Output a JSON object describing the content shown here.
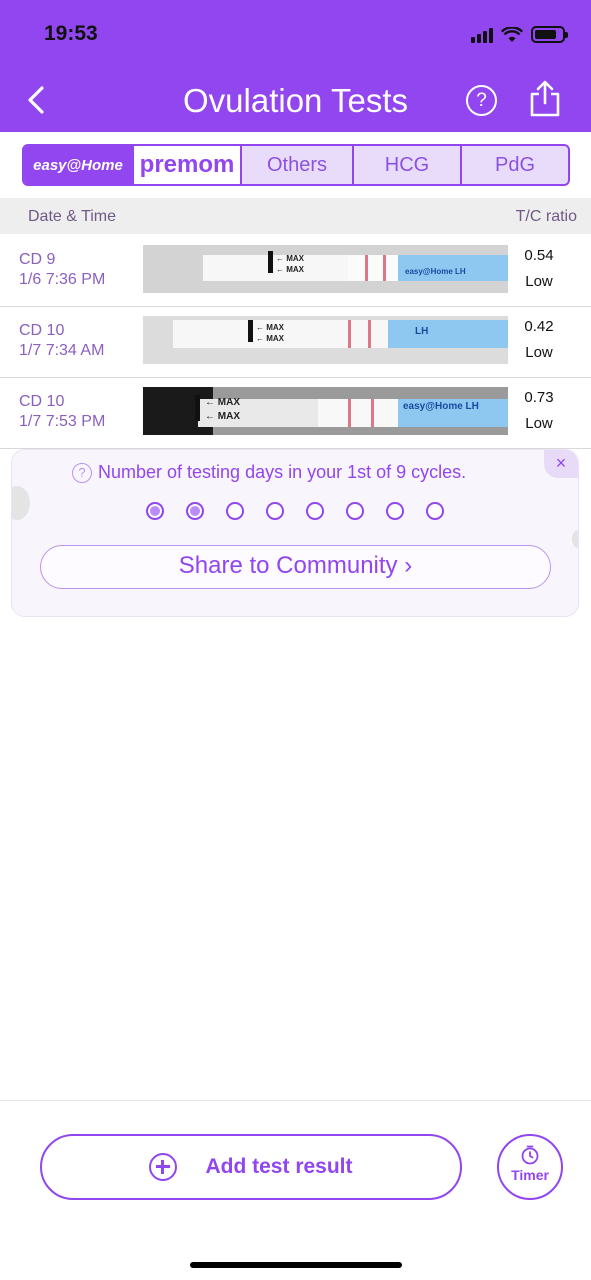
{
  "status_bar": {
    "time": "19:53"
  },
  "header": {
    "title": "Ovulation Tests",
    "help_label": "?"
  },
  "tabs": [
    {
      "label": "easy@Home"
    },
    {
      "label": "premom"
    },
    {
      "label": "Others"
    },
    {
      "label": "HCG"
    },
    {
      "label": "PdG"
    }
  ],
  "list_header": {
    "left": "Date & Time",
    "right": "T/C ratio"
  },
  "rows": [
    {
      "cd": "CD 9",
      "datetime": "1/6 7:36 PM",
      "ratio": "0.54",
      "level": "Low",
      "strip_text": "MAX",
      "brand_text": "easy@Home LH"
    },
    {
      "cd": "CD 10",
      "datetime": "1/7 7:34 AM",
      "ratio": "0.42",
      "level": "Low",
      "strip_text": "MAX",
      "brand_text": "LH"
    },
    {
      "cd": "CD 10",
      "datetime": "1/7 7:53 PM",
      "ratio": "0.73",
      "level": "Low",
      "strip_text": "MAX",
      "brand_text": "easy@Home LH"
    }
  ],
  "cycle_card": {
    "info": "Number of testing days in your 1st of 9 cycles.",
    "info_icon": "?",
    "close_label": "×",
    "dots_filled": 2,
    "dots_total": 8,
    "share_button": "Share to Community ›"
  },
  "bottom": {
    "add_label": "Add test result",
    "timer_label": "Timer"
  },
  "colors": {
    "accent": "#9146ef",
    "header_bg": "#9146ef",
    "row_text": "#8a5fbf"
  }
}
